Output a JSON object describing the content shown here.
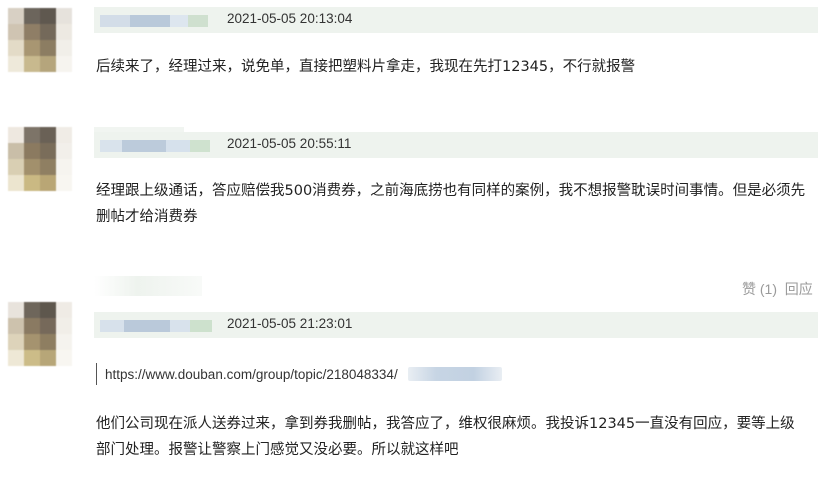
{
  "comments": [
    {
      "timestamp": "2021-05-05 20:13:04",
      "text": "后续来了，经理过来，说免单，直接把塑料片拿走，我现在先打12345，不行就报警"
    },
    {
      "timestamp": "2021-05-05 20:55:11",
      "text": "经理跟上级通话，答应赔偿我500消费券，之前海底捞也有同样的案例，我不想报警耽误时间事情。但是必须先删帖才给消费券"
    },
    {
      "timestamp": "2021-05-05 21:23:01",
      "quote_url": "https://www.douban.com/group/topic/218048334/",
      "text": "他们公司现在派人送券过来，拿到券我删帖，我答应了，维权很麻烦。我投诉12345一直没有回应，要等上级部门处理。报警让警察上门感觉又没必要。所以就这样吧"
    }
  ],
  "actions": {
    "like_label": "赞 (1)",
    "reply_label": "回应"
  }
}
